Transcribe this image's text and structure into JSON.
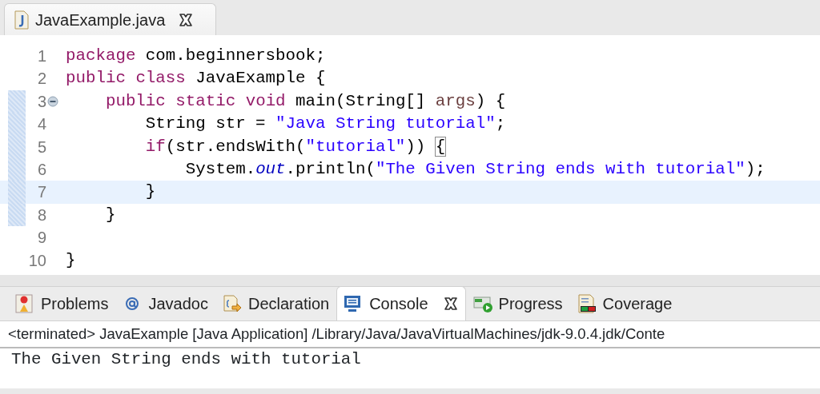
{
  "editor": {
    "tab": {
      "label": "JavaExample.java",
      "selected": true
    },
    "lines": [
      {
        "number": "1",
        "marked": false,
        "foldable": false,
        "current": false,
        "tokens": [
          {
            "kind": "keyword",
            "text": "package"
          },
          {
            "kind": "plain",
            "text": " com.beginnersbook;"
          }
        ]
      },
      {
        "number": "2",
        "marked": false,
        "foldable": false,
        "current": false,
        "tokens": [
          {
            "kind": "keyword",
            "text": "public "
          },
          {
            "kind": "keyword",
            "text": "class"
          },
          {
            "kind": "plain",
            "text": " JavaExample {"
          }
        ]
      },
      {
        "number": "3",
        "marked": true,
        "foldable": true,
        "current": false,
        "tokens": [
          {
            "kind": "keyword",
            "text": "    public "
          },
          {
            "kind": "keyword",
            "text": "static "
          },
          {
            "kind": "keyword",
            "text": "void"
          },
          {
            "kind": "plain",
            "text": " main(String[] "
          },
          {
            "kind": "param",
            "text": "args"
          },
          {
            "kind": "plain",
            "text": ") {"
          }
        ]
      },
      {
        "number": "4",
        "marked": true,
        "foldable": false,
        "current": false,
        "tokens": [
          {
            "kind": "plain",
            "text": "        String str = "
          },
          {
            "kind": "string",
            "text": "\"Java String tutorial\""
          },
          {
            "kind": "plain",
            "text": ";"
          }
        ]
      },
      {
        "number": "5",
        "marked": true,
        "foldable": false,
        "current": false,
        "tokens": [
          {
            "kind": "keyword",
            "text": "        if"
          },
          {
            "kind": "plain",
            "text": "(str.endsWith("
          },
          {
            "kind": "string",
            "text": "\"tutorial\""
          },
          {
            "kind": "plain",
            "text": ")) "
          },
          {
            "kind": "bracket",
            "text": "{"
          }
        ]
      },
      {
        "number": "6",
        "marked": true,
        "foldable": false,
        "current": false,
        "tokens": [
          {
            "kind": "plain",
            "text": "            System."
          },
          {
            "kind": "field",
            "text": "out"
          },
          {
            "kind": "plain",
            "text": ".println("
          },
          {
            "kind": "string",
            "text": "\"The Given String ends with tutorial\""
          },
          {
            "kind": "plain",
            "text": ");"
          }
        ]
      },
      {
        "number": "7",
        "marked": true,
        "foldable": false,
        "current": true,
        "tokens": [
          {
            "kind": "plain",
            "text": "        }"
          }
        ]
      },
      {
        "number": "8",
        "marked": true,
        "foldable": false,
        "current": false,
        "tokens": [
          {
            "kind": "plain",
            "text": "    }"
          }
        ]
      },
      {
        "number": "9",
        "marked": false,
        "foldable": false,
        "current": false
      },
      {
        "number": "10",
        "marked": false,
        "foldable": false,
        "current": false,
        "tokens": [
          {
            "kind": "plain",
            "text": "}"
          }
        ]
      }
    ]
  },
  "console_panel": {
    "tabs": [
      {
        "kind": "problems",
        "label": "Problems",
        "selected": false
      },
      {
        "kind": "javadoc",
        "label": "Javadoc",
        "selected": false
      },
      {
        "kind": "declaration",
        "label": "Declaration",
        "selected": false
      },
      {
        "kind": "console",
        "label": "Console",
        "selected": true
      },
      {
        "kind": "progress",
        "label": "Progress",
        "selected": false
      },
      {
        "kind": "coverage",
        "label": "Coverage",
        "selected": false
      }
    ],
    "header": "<terminated> JavaExample [Java Application] /Library/Java/JavaVirtualMachines/jdk-9.0.4.jdk/Conte",
    "output": [
      "The Given String ends with tutorial"
    ]
  }
}
